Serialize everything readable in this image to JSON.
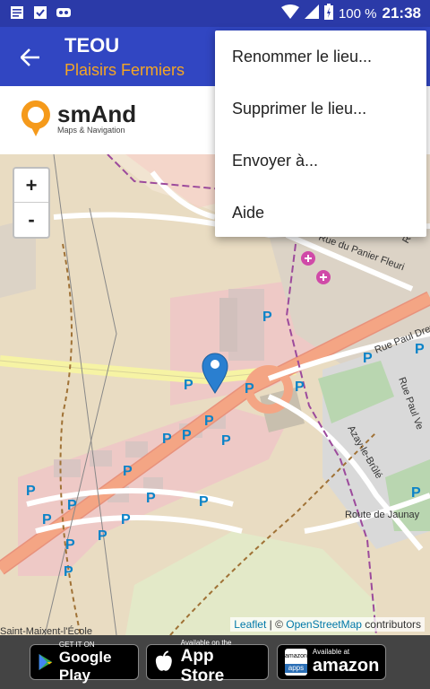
{
  "status_bar": {
    "battery": "100 %",
    "time": "21:38"
  },
  "appbar": {
    "title": "TEOU",
    "subtitle": "Plaisirs Fermiers"
  },
  "banner": {
    "logo_name": "smAnd",
    "logo_tagline": "Maps & Navigation"
  },
  "menu": {
    "items": [
      {
        "label": "Renommer le lieu..."
      },
      {
        "label": "Supprimer le lieu..."
      },
      {
        "label": "Envoyer à..."
      },
      {
        "label": "Aide"
      }
    ]
  },
  "map": {
    "zoom_in": "+",
    "zoom_out": "-",
    "streets": [
      "Rue du Panier Fleuri",
      "Rue Paul Dreva",
      "Azay-le-Brûlé",
      "Route de Jaunay",
      "Saint-Maixent-l'École",
      "Rue Paul Ve",
      "Rue G"
    ],
    "parking_label": "P",
    "attribution": {
      "leaflet": "Leaflet",
      "separator": " | © ",
      "osm": "OpenStreetMap",
      "suffix": " contributors"
    }
  },
  "stores": {
    "google": {
      "small": "GET IT ON",
      "big": "Google Play"
    },
    "apple": {
      "small": "Available on the",
      "big": "App Store"
    },
    "amazon": {
      "small": "Available at",
      "big": "amazon",
      "badge_top": "amazon",
      "badge_bottom": "apps"
    }
  }
}
